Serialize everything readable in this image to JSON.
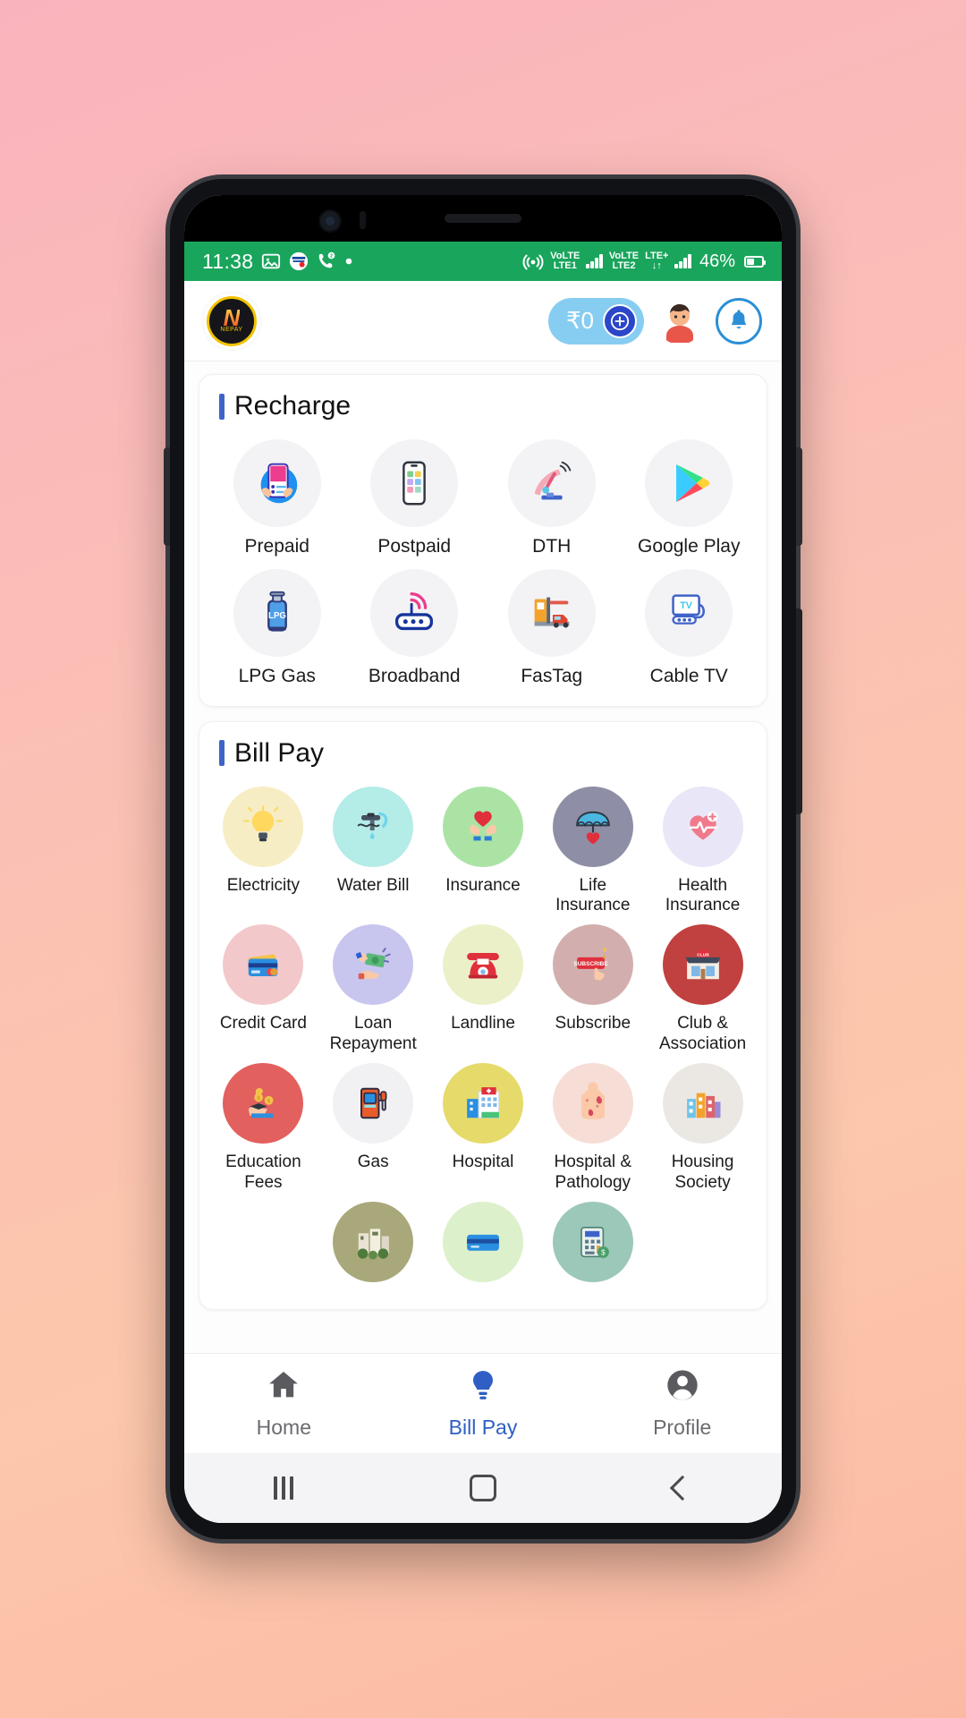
{
  "status_bar": {
    "time": "11:38",
    "battery_percent": "46%",
    "left_icons": [
      "photo-icon",
      "hdfc-bank-icon",
      "missed-call-icon",
      "dot-icon"
    ],
    "right_icons": [
      "hotspot-icon",
      "volte-sim1-icon",
      "signal-sim1-icon",
      "volte-sim2-icon",
      "lte-plus-icon",
      "data-transfer-icon",
      "signal-sim2-icon"
    ],
    "sim1_label": "VoLTE",
    "sim1_network": "LTE1",
    "sim2_label": "VoLTE",
    "sim2_network": "LTE2",
    "lte_plus": "LTE+",
    "background_color": "#19a55c"
  },
  "header": {
    "logo_letter": "N",
    "logo_text": "NEPAY",
    "wallet_amount": "₹0",
    "add_money_icon": "plus-circle-icon",
    "avatar_icon": "user-avatar-icon",
    "notification_icon": "bell-icon"
  },
  "recharge": {
    "title": "Recharge",
    "accent_color": "#3f63c9",
    "items": [
      {
        "label": "Prepaid",
        "icon": "prepaid-phone-icon"
      },
      {
        "label": "Postpaid",
        "icon": "postpaid-phone-icon"
      },
      {
        "label": "DTH",
        "icon": "satellite-dish-icon"
      },
      {
        "label": "Google Play",
        "icon": "google-play-icon"
      },
      {
        "label": "LPG Gas",
        "icon": "gas-cylinder-icon"
      },
      {
        "label": "Broadband",
        "icon": "router-icon"
      },
      {
        "label": "FasTag",
        "icon": "toll-booth-icon"
      },
      {
        "label": "Cable TV",
        "icon": "cable-tv-icon"
      }
    ]
  },
  "bill_pay": {
    "title": "Bill Pay",
    "accent_color": "#3f63c9",
    "items": [
      {
        "label": "Electricity",
        "icon": "light-bulb-icon",
        "bg": "#f7edc4"
      },
      {
        "label": "Water Bill",
        "icon": "water-tap-icon",
        "bg": "#b4ece7"
      },
      {
        "label": "Insurance",
        "icon": "hands-heart-icon",
        "bg": "#abe3a5"
      },
      {
        "label": "Life\nInsurance",
        "icon": "umbrella-heart-icon",
        "bg": "#8e8fa6"
      },
      {
        "label": "Health\nInsurance",
        "icon": "heartbeat-icon",
        "bg": "#e9e6f7"
      },
      {
        "label": "Credit Card",
        "icon": "credit-card-icon",
        "bg": "#f3c8cb"
      },
      {
        "label": "Loan\nRepayment",
        "icon": "cash-hand-icon",
        "bg": "#c8c6ef"
      },
      {
        "label": "Landline",
        "icon": "landline-phone-icon",
        "bg": "#ecf0c9"
      },
      {
        "label": "Subscribe",
        "icon": "subscribe-button-icon",
        "bg": "#d2afae"
      },
      {
        "label": "Club &\nAssociation",
        "icon": "club-building-icon",
        "bg": "#c0413f"
      },
      {
        "label": "Education\nFees",
        "icon": "education-money-icon",
        "bg": "#e2605e"
      },
      {
        "label": "Gas",
        "icon": "fuel-pump-icon",
        "bg": "#f1f1f3"
      },
      {
        "label": "Hospital",
        "icon": "hospital-icon",
        "bg": "#e6da6a"
      },
      {
        "label": "Hospital &\nPathology",
        "icon": "pathology-body-icon",
        "bg": "#f6ddd6"
      },
      {
        "label": "Housing\nSociety",
        "icon": "housing-society-icon",
        "bg": "#ebe8e4"
      },
      {
        "label": "",
        "icon": "municipal-tax-icon",
        "bg": "#a9a87b"
      },
      {
        "label": "",
        "icon": "debit-card-icon",
        "bg": "#dcf0cb"
      },
      {
        "label": "",
        "icon": "tax-calculator-icon",
        "bg": "#9cc8b9"
      }
    ]
  },
  "bottom_nav": {
    "items": [
      {
        "label": "Home",
        "icon": "home-icon",
        "active": false
      },
      {
        "label": "Bill Pay",
        "icon": "bulb-icon",
        "active": true
      },
      {
        "label": "Profile",
        "icon": "profile-icon",
        "active": false
      }
    ],
    "active_color": "#2f5fc4",
    "inactive_color": "#6b6b70"
  },
  "system_nav": {
    "recent_icon": "recent-apps-icon",
    "home_icon": "system-home-icon",
    "back_icon": "system-back-icon"
  }
}
